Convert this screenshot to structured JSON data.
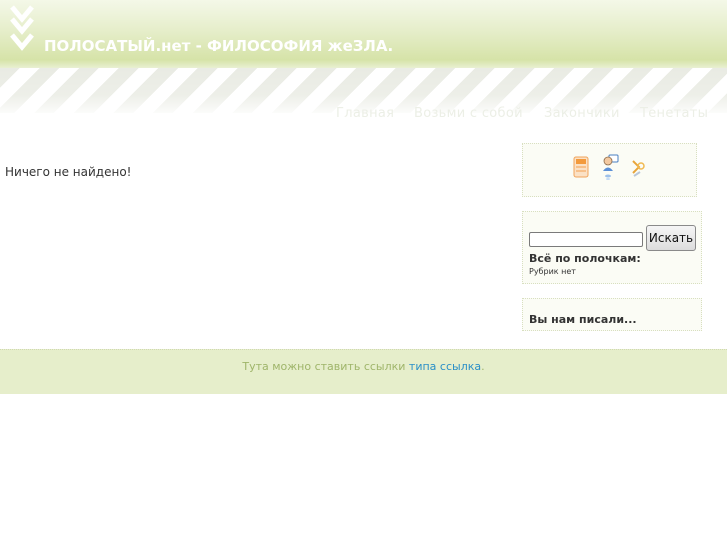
{
  "header": {
    "title": "ПОЛОСАТЫЙ.нет - ФИЛОСОФИЯ жеЗЛА.",
    "logo_icon": "double-chevron-down-icon"
  },
  "nav": {
    "items": [
      {
        "label": "Главная"
      },
      {
        "label": "Возьми с собой"
      },
      {
        "label": "Закончики"
      },
      {
        "label": "Тенетаты"
      }
    ]
  },
  "main": {
    "empty_message": "Ничего не найдено!"
  },
  "sidebar": {
    "icons": [
      "rss-feed-icon",
      "user-profile-icon",
      "key-login-icon"
    ],
    "search": {
      "value": "",
      "button_label": "Искать"
    },
    "categories": {
      "title": "Всё по полочкам:",
      "empty_text": "Рубрик нет"
    },
    "comments": {
      "title": "Вы нам писали..."
    }
  },
  "footer": {
    "text": "Тута можно ставить ссылки ",
    "link_text": "типа ссылка",
    "suffix": "."
  },
  "colors": {
    "header_green": "#d6e3a8",
    "footer_bg": "#e6eecb",
    "link_blue": "#2a8fc8"
  }
}
